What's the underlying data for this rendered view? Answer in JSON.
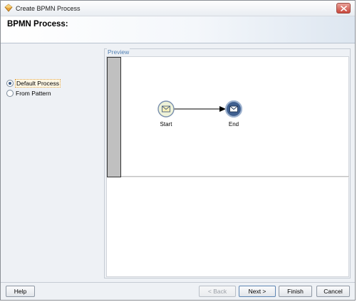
{
  "window": {
    "title": "Create BPMN Process"
  },
  "header": {
    "title": "BPMN Process:"
  },
  "options": {
    "items": [
      {
        "label": "Default Process",
        "selected": true
      },
      {
        "label": "From Pattern",
        "selected": false
      }
    ]
  },
  "preview": {
    "legend": "Preview",
    "start_label": "Start",
    "end_label": "End",
    "start_icon": "envelope-icon",
    "end_icon": "envelope-icon"
  },
  "buttons": {
    "help": "Help",
    "back": "< Back",
    "next": "Next >",
    "finish": "Finish",
    "cancel": "Cancel"
  },
  "colors": {
    "accent": "#4f7fb3",
    "lane": "#c0c0c0",
    "start_event_fill": "#eef2d8",
    "end_event_fill": "#3f5f8f"
  }
}
